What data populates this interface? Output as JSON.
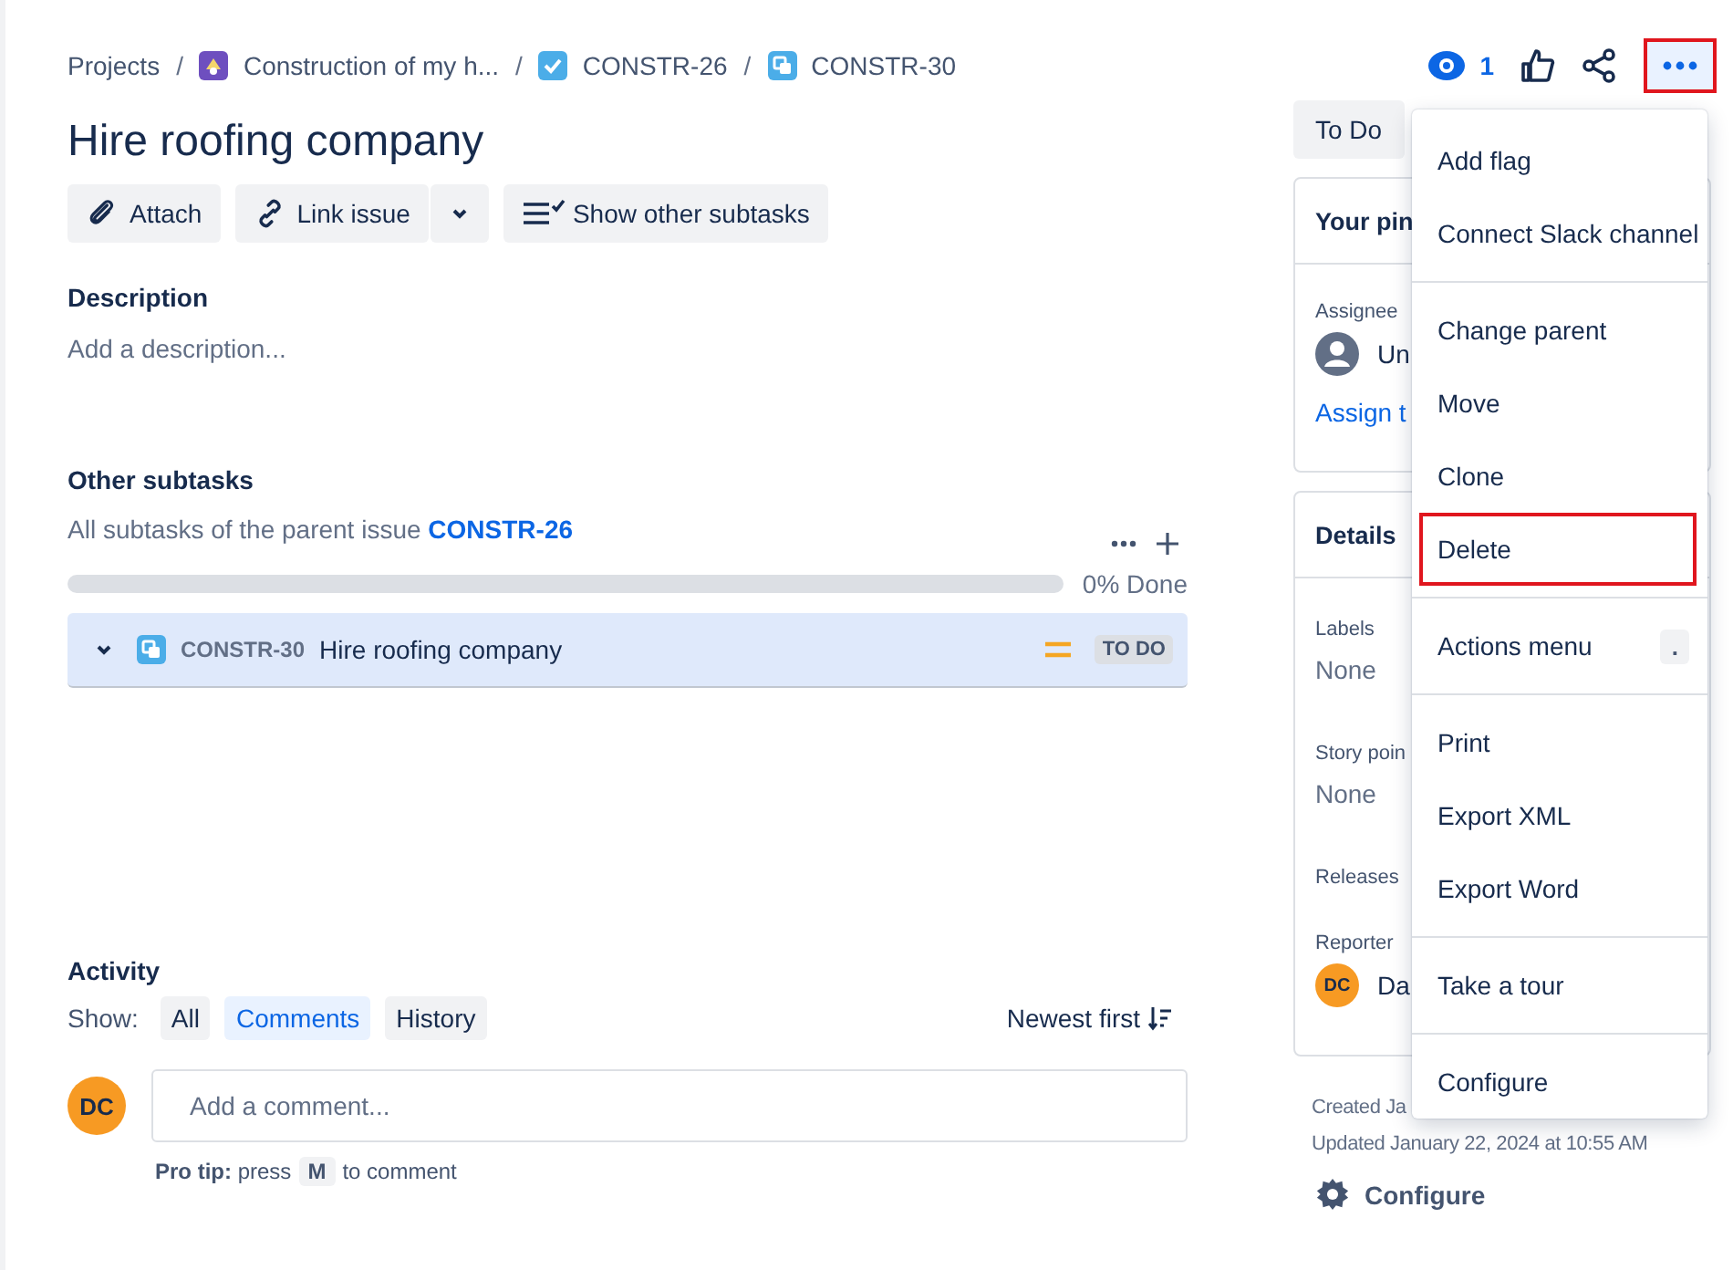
{
  "breadcrumbs": [
    {
      "label": "Projects",
      "kind": "text"
    },
    {
      "label": "Construction of my h...",
      "kind": "project",
      "separator": "/"
    },
    {
      "label": "CONSTR-26",
      "kind": "task",
      "separator": "/"
    },
    {
      "label": "CONSTR-30",
      "kind": "subtask",
      "separator": "/"
    }
  ],
  "header_actions": {
    "watchers": "1",
    "more_highlighted": true
  },
  "title": "Hire roofing company",
  "toolbar": [
    {
      "label": "Attach",
      "kind": "attach"
    },
    {
      "label": "Link issue",
      "kind": "link"
    },
    {
      "label": "Show other subtasks",
      "kind": "subtasks"
    }
  ],
  "description": {
    "heading": "Description",
    "placeholder": "Add a description..."
  },
  "subtasks": {
    "heading": "Other subtasks",
    "intro": "All subtasks of the parent issue",
    "parent_link": "CONSTR-26",
    "progress": {
      "level": 0,
      "reading": "0% Done"
    },
    "items": [
      {
        "key": "CONSTR-30",
        "summary": "Hire roofing company",
        "status": "TO DO"
      }
    ]
  },
  "activity": {
    "heading": "Activity",
    "show_label": "Show:",
    "filters": [
      {
        "label": "All",
        "selected": false
      },
      {
        "label": "Comments",
        "selected": true
      },
      {
        "label": "History",
        "selected": false
      }
    ],
    "sort": "Newest first",
    "avatar": "DC",
    "comment_placeholder": "Add a comment...",
    "tip": {
      "before": "**Pro tip:** press",
      "key": "M",
      "after": "to comment"
    }
  },
  "side": {
    "status": "To Do",
    "pinned": "Your pin",
    "assignee_label": "Assignee",
    "assignee": "Un",
    "assign_link": "Assign t",
    "details": "Details",
    "fields": [
      {
        "label": "Labels",
        "value": "None"
      },
      {
        "label": "Story poin",
        "value": "None"
      },
      {
        "label": "Releases"
      },
      {
        "label": "Reporter",
        "value": "Da",
        "avatar": "DC"
      }
    ],
    "created": "Created Ja",
    "updated": "Updated January 22, 2024 at 10:55 AM",
    "configure": "Configure"
  },
  "menu": [
    [
      {
        "label": "Add flag",
        "highlighted": false
      },
      {
        "label": "Connect Slack channel",
        "highlighted": false
      }
    ],
    [
      {
        "label": "Change parent",
        "highlighted": false
      },
      {
        "label": "Move",
        "highlighted": false
      },
      {
        "label": "Clone",
        "highlighted": false
      },
      {
        "label": "Delete",
        "highlighted": true
      }
    ],
    [
      {
        "label": "Actions menu",
        "highlighted": false,
        "shortcut": "."
      }
    ],
    [
      {
        "label": "Print",
        "highlighted": false
      },
      {
        "label": "Export XML",
        "highlighted": false
      },
      {
        "label": "Export Word",
        "highlighted": false
      }
    ],
    [
      {
        "label": "Take a tour",
        "highlighted": false
      }
    ],
    [
      {
        "label": "Configure",
        "highlighted": false
      }
    ]
  ]
}
